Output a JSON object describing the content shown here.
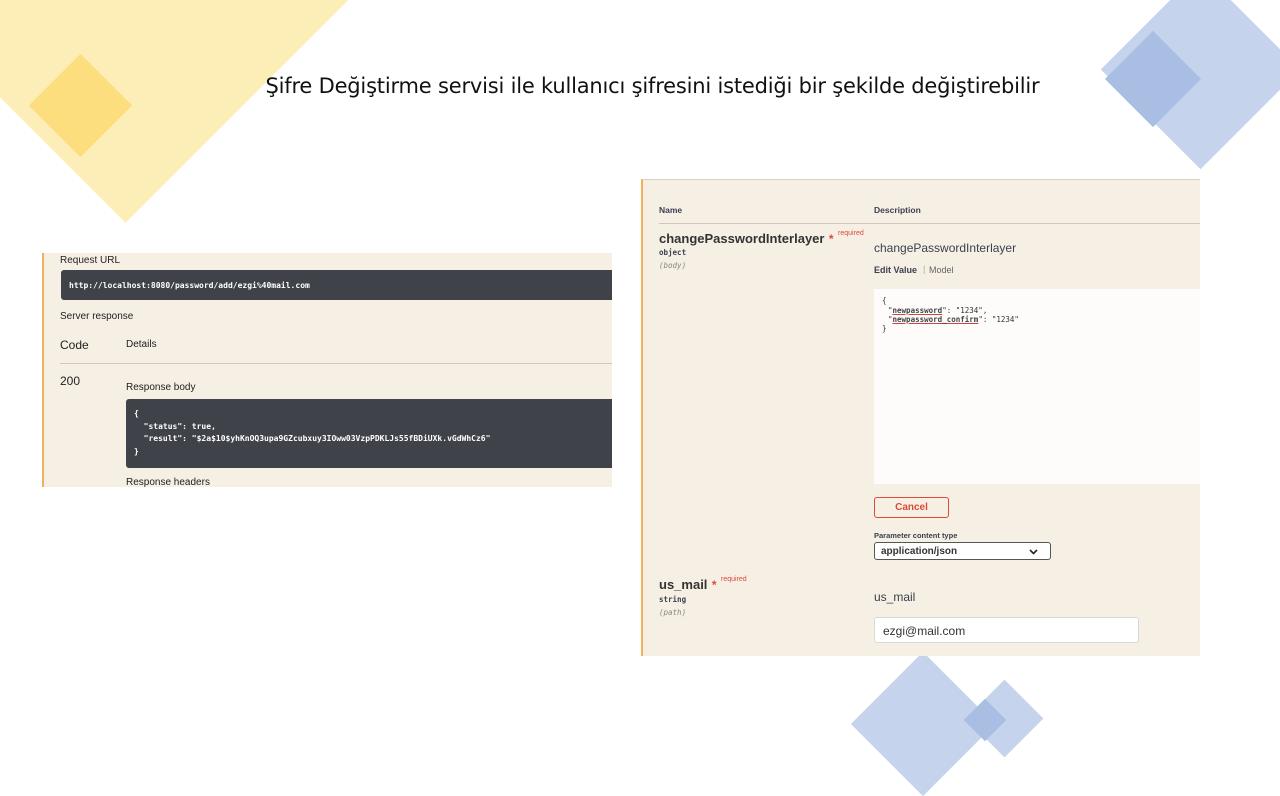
{
  "slide": {
    "title": "Şifre Değiştirme servisi ile kullanıcı şifresini istediği bir şekilde değiştirebilir"
  },
  "left_panel": {
    "request_url_label": "Request URL",
    "request_url": "http://localhost:8080/password/add/ezgi%40mail.com",
    "server_response_label": "Server response",
    "code_header": "Code",
    "details_header": "Details",
    "code_value": "200",
    "response_body_label": "Response body",
    "body_lines": [
      "{",
      "  \"status\": true,",
      "  \"result\": \"$2a$10$yhKnOQ3upa9GZcubxuy3IOww03VzpPDKLJs55fBDiUXk.vGdWhCz6\"",
      "}"
    ],
    "response_headers_label": "Response headers"
  },
  "right_panel": {
    "name_header": "Name",
    "description_header": "Description",
    "param1": {
      "name": "changePasswordInterlayer",
      "required_star": "*",
      "required_text": "required",
      "type": "object",
      "location": "(body)",
      "description": "changePasswordInterlayer",
      "edit_value_tab": "Edit Value",
      "separator": "|",
      "model_tab": "Model",
      "json": {
        "open": "{",
        "key1": "newpassword",
        "val1": "\"1234\",",
        "key2": "newpassword_confirm",
        "val2": "\"1234\"",
        "close": "}"
      },
      "cancel_label": "Cancel",
      "content_type_label": "Parameter content type",
      "content_type_value": "application/json"
    },
    "param2": {
      "name": "us_mail",
      "required_star": "*",
      "required_text": "required",
      "type": "string",
      "location": "(path)",
      "description": "us_mail",
      "value": "ezgi@mail.com"
    }
  },
  "colors": {
    "swagger_bg": "#f6efe4",
    "dark_code_bg": "#3f4248",
    "required_red": "#e0483b",
    "accent_orange": "#efb15c",
    "deco_yellow": "#fde9a6",
    "deco_blue": "#c5d4ec"
  }
}
